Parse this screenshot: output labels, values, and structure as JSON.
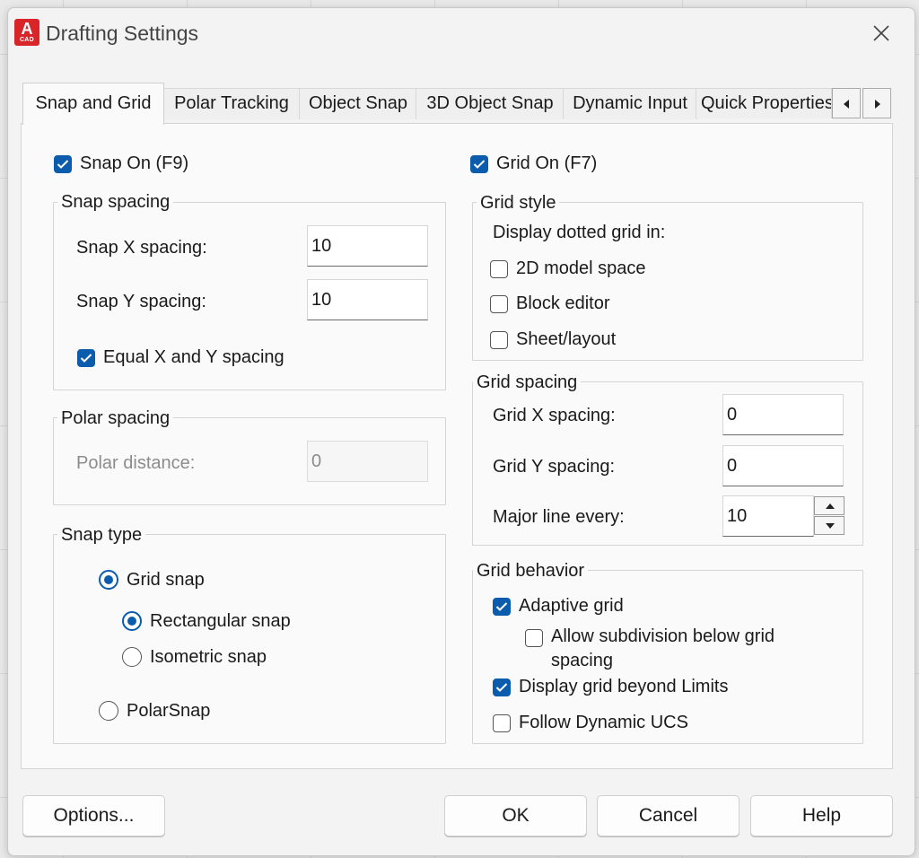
{
  "window": {
    "title": "Drafting Settings",
    "app_icon": {
      "letter": "A",
      "caption": "CAD"
    },
    "close_icon": "close-icon"
  },
  "tabs": [
    {
      "label": "Snap and Grid",
      "active": true
    },
    {
      "label": "Polar Tracking"
    },
    {
      "label": "Object Snap"
    },
    {
      "label": "3D Object Snap"
    },
    {
      "label": "Dynamic Input"
    },
    {
      "label": "Quick Properties"
    }
  ],
  "tab_scroll": {
    "left_icon": "triangle-left-icon",
    "right_icon": "triangle-right-icon"
  },
  "snap": {
    "on_label": "Snap On (F9)",
    "on_checked": true,
    "spacing": {
      "title": "Snap spacing",
      "x_label": "Snap X spacing:",
      "x_value": "10",
      "y_label": "Snap Y spacing:",
      "y_value": "10",
      "equal_label": "Equal X and Y spacing",
      "equal_checked": true
    },
    "polar": {
      "title": "Polar spacing",
      "distance_label": "Polar distance:",
      "distance_value": "0"
    },
    "type": {
      "title": "Snap type",
      "grid_snap": "Grid snap",
      "rectangular": "Rectangular snap",
      "isometric": "Isometric snap",
      "polarsnap": "PolarSnap",
      "selected_type": "Grid snap",
      "selected_subtype": "Rectangular snap"
    }
  },
  "grid": {
    "on_label": "Grid On (F7)",
    "on_checked": true,
    "style": {
      "title": "Grid style",
      "display_label": "Display dotted grid in:",
      "model_space": "2D model space",
      "block_editor": "Block editor",
      "sheet_layout": "Sheet/layout"
    },
    "spacing": {
      "title": "Grid spacing",
      "x_label": "Grid X spacing:",
      "x_value": "0",
      "y_label": "Grid Y spacing:",
      "y_value": "0",
      "major_label": "Major line every:",
      "major_value": "10"
    },
    "behavior": {
      "title": "Grid behavior",
      "adaptive": "Adaptive grid",
      "adaptive_checked": true,
      "subdivision_line1": "Allow subdivision below grid",
      "subdivision_line2": "spacing",
      "beyond_limits": "Display grid beyond Limits",
      "beyond_checked": true,
      "follow_ucs": "Follow Dynamic UCS"
    }
  },
  "buttons": {
    "options": "Options...",
    "ok": "OK",
    "cancel": "Cancel",
    "help": "Help"
  },
  "colors": {
    "accent": "#0b5cad",
    "app_red": "#d9252a"
  }
}
